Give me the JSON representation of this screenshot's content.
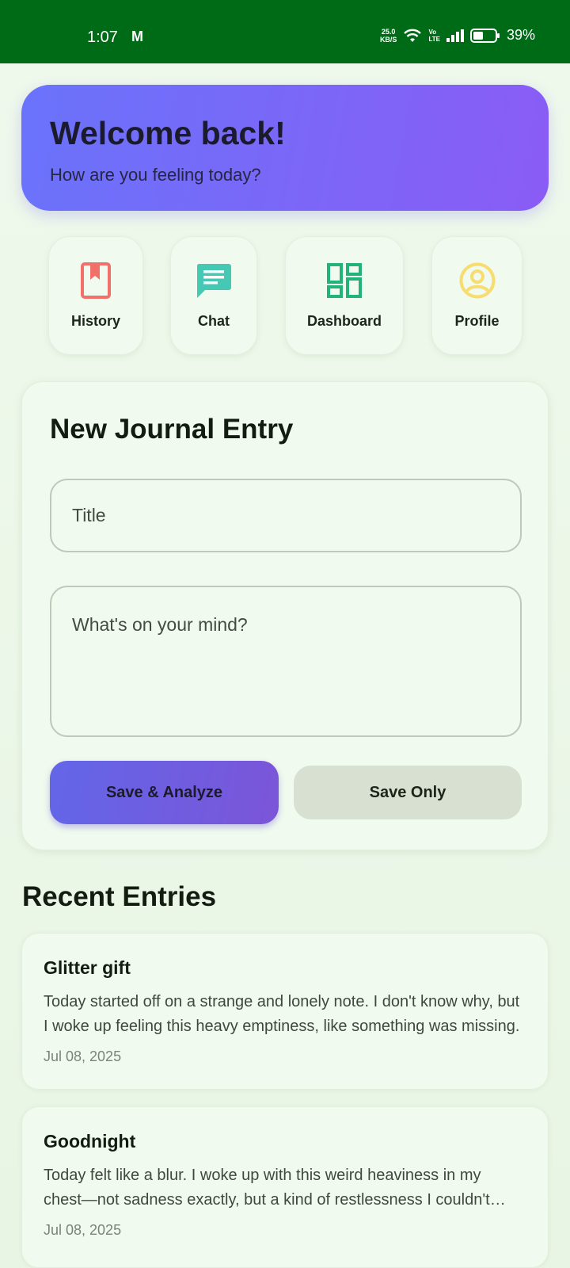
{
  "status_bar": {
    "time": "1:07",
    "mail_glyph": "M",
    "net_speed_value": "25.0",
    "net_speed_unit": "KB/S",
    "volte_top": "Vo",
    "volte_bottom": "LTE",
    "battery": "39%"
  },
  "welcome": {
    "title": "Welcome back!",
    "subtitle": "How are you feeling today?"
  },
  "quick_nav": [
    {
      "label": "History",
      "icon": "bookmark-icon",
      "color": "#f2706a"
    },
    {
      "label": "Chat",
      "icon": "chat-icon",
      "color": "#45c9b5"
    },
    {
      "label": "Dashboard",
      "icon": "dashboard-icon",
      "color": "#22b37a"
    },
    {
      "label": "Profile",
      "icon": "profile-icon",
      "color": "#f7dc6f"
    }
  ],
  "journal": {
    "heading": "New Journal Entry",
    "title_placeholder": "Title",
    "body_placeholder": "What's on your mind?",
    "analyze_button": "Save & Analyze",
    "save_button": "Save Only"
  },
  "recent": {
    "heading": "Recent Entries",
    "entries": [
      {
        "title": "Glitter gift",
        "preview": "Today started off on a strange and lonely note. I don't know why, but I woke up feeling this heavy emptiness, like something was missing.",
        "date": "Jul 08, 2025"
      },
      {
        "title": "Goodnight",
        "preview": "Today felt like a blur. I woke up with this weird heaviness in my chest—not sadness exactly, but a kind of restlessness I couldn't shake.",
        "date": "Jul 08, 2025"
      }
    ]
  },
  "colors": {
    "status_bar": "#006b17",
    "background": "#eff9ec",
    "card": "#f1faee",
    "accent_start": "#6a73fb",
    "accent_end": "#8a5cf5"
  }
}
